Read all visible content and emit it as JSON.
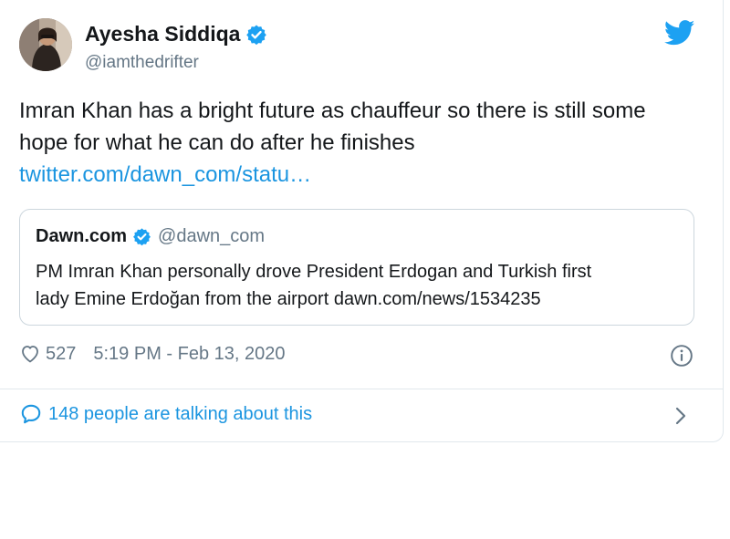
{
  "author": {
    "display_name": "Ayesha Siddiqa",
    "handle": "@iamthedrifter",
    "verified": true
  },
  "tweet": {
    "text_lines": [
      "Imran Khan has a bright future as chauffeur so there is still some",
      "hope for what he can do after he finishes"
    ],
    "link": "twitter.com/dawn_com/statu…"
  },
  "quoted_tweet": {
    "display_name": "Dawn.com",
    "handle": "@dawn_com",
    "verified": true,
    "text_lines": [
      "PM Imran Khan personally drove President Erdogan and Turkish first",
      "lady Emine Erdoğan from the airport dawn.com/news/1534235"
    ]
  },
  "meta": {
    "like_count": "527",
    "timestamp": "5:19 PM - Feb 13, 2020"
  },
  "footer": {
    "talking_label": "148 people are talking about this"
  },
  "icons": {
    "brand": "twitter-bird-icon",
    "verified": "verified-badge-icon",
    "like": "heart-icon",
    "info": "info-icon",
    "conversation": "speech-bubble-icon",
    "more": "chevron-right-icon"
  },
  "colors": {
    "brand_blue": "#1da1f2",
    "link_blue": "#1b95e0",
    "secondary_text": "#657786",
    "primary_text": "#14171a",
    "border": "#e1e8ed"
  }
}
